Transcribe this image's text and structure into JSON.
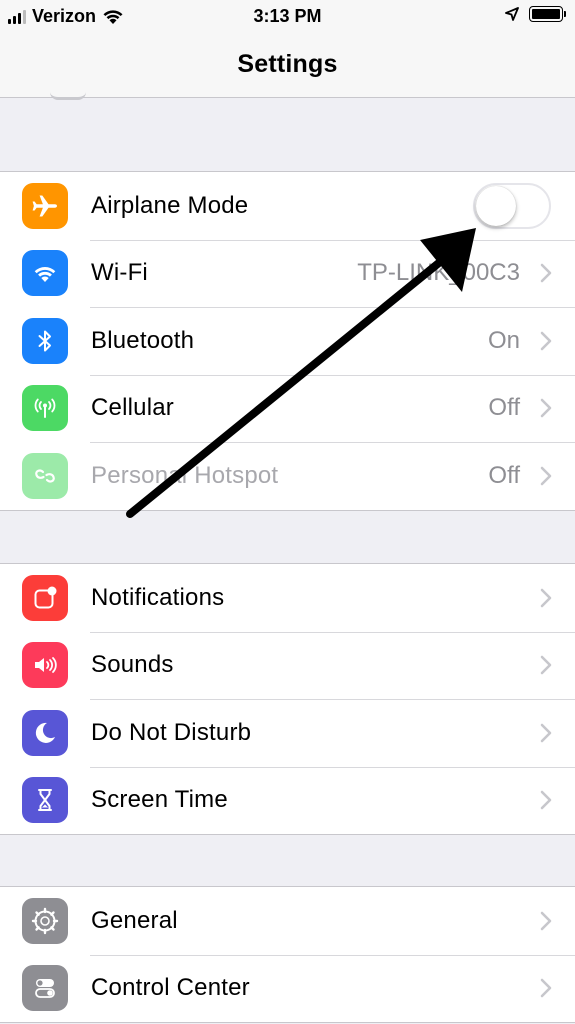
{
  "status_bar": {
    "carrier": "Verizon",
    "time": "3:13 PM",
    "icons": [
      "signal-bars-icon",
      "wifi-icon",
      "location-arrow-icon",
      "battery-icon"
    ]
  },
  "nav": {
    "title": "Settings"
  },
  "groups": {
    "connectivity": {
      "airplane": {
        "label": "Airplane Mode",
        "toggle_on": false,
        "icon": "airplane-icon",
        "color": "#ff9500"
      },
      "wifi": {
        "label": "Wi-Fi",
        "value": "TP-LINK_00C3",
        "icon": "wifi-icon",
        "color": "#1a82fb"
      },
      "bluetooth": {
        "label": "Bluetooth",
        "value": "On",
        "icon": "bluetooth-icon",
        "color": "#1a82fb"
      },
      "cellular": {
        "label": "Cellular",
        "value": "Off",
        "icon": "cellular-antenna-icon",
        "color": "#4cd964"
      },
      "hotspot": {
        "label": "Personal Hotspot",
        "value": "Off",
        "icon": "hotspot-link-icon",
        "color": "#4cd964",
        "disabled": true
      }
    },
    "alerts": {
      "notifications": {
        "label": "Notifications",
        "icon": "notifications-icon",
        "color": "#fc3d39"
      },
      "sounds": {
        "label": "Sounds",
        "icon": "speaker-icon",
        "color": "#fd3a5a"
      },
      "dnd": {
        "label": "Do Not Disturb",
        "icon": "moon-icon",
        "color": "#5856d6"
      },
      "screen_time": {
        "label": "Screen Time",
        "icon": "hourglass-icon",
        "color": "#5856d6"
      }
    },
    "system": {
      "general": {
        "label": "General",
        "icon": "gear-icon",
        "color": "#8e8e93"
      },
      "control_center": {
        "label": "Control Center",
        "icon": "toggles-icon",
        "color": "#8e8e93"
      }
    }
  },
  "annotation": {
    "icon": "pointer-arrow-icon",
    "color": "#000000"
  }
}
